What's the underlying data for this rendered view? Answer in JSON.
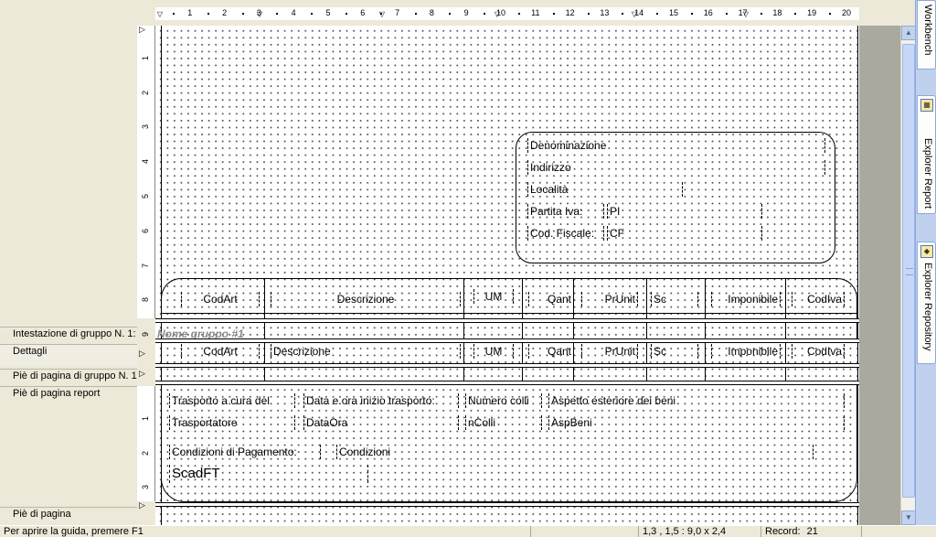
{
  "bands": {
    "group_header": "Intestazione di gruppo N. 1:",
    "details": "Dettagli",
    "group_footer": "Piè di pagina di gruppo N. 1",
    "report_footer": "Piè di pagina report",
    "page_footer": "Piè di pagina"
  },
  "ruler": {
    "h_numbers": [
      "1",
      "2",
      "3",
      "4",
      "5",
      "6",
      "7",
      "8",
      "9",
      "10",
      "11",
      "12",
      "13",
      "14",
      "15",
      "16",
      "17",
      "18",
      "19",
      "20"
    ],
    "v_numbers_header": [
      "1",
      "2",
      "3",
      "4",
      "5",
      "6",
      "7",
      "8",
      "9"
    ],
    "v_numbers_footer": [
      "1",
      "2",
      "3"
    ]
  },
  "customer": {
    "denominazione": "Denominazione",
    "indirizzo": "Indirizzo",
    "localita": "Località",
    "partita_iva_label": "Partita Iva:",
    "partita_iva_value": "PI",
    "cod_fiscale_label": "Cod. Fiscale:",
    "cod_fiscale_value": "CF"
  },
  "columns_header": {
    "codart": "CodArt",
    "descrizione": "Descrizione",
    "um": "UM",
    "qant": "Qant",
    "prunit": "PrUnit",
    "sc": "Sc",
    "imponibile": "Imponibile",
    "codiva": "CodIva"
  },
  "group": {
    "name": "Nome gruppo #1"
  },
  "details_row": {
    "codart": "CodArt",
    "descrizione": "Descrizione",
    "um": "UM",
    "qant": "Qant",
    "prunit": "PrUnit",
    "sc": "Sc",
    "imponibile": "Imponibile",
    "codiva": "CodIva"
  },
  "footer": {
    "trasporto_label": "Trasporto a cura del",
    "trasporto_value": "Trasportatore",
    "data_label": "Data e ora inizio trasporto:",
    "data_value": "DataOra",
    "colli_label": "Numero colli",
    "colli_value": "nColli",
    "aspetto_label": "Aspetto esteriore dei beni",
    "aspetto_value": "AspBeni",
    "condizioni_label": "Condizioni di Pagamento:",
    "condizioni_value": "Condizioni",
    "scadenze": "ScadFT"
  },
  "side_tabs": {
    "workbench": "Workbench",
    "explorer_report": "Explorer Report",
    "explorer_repository": "Explorer Repository"
  },
  "status": {
    "help": "Per aprire la guida, premere F1",
    "position": "1,3 , 1,5 : 9,0 x 2,4",
    "record": "Record:",
    "record_num": "21"
  }
}
